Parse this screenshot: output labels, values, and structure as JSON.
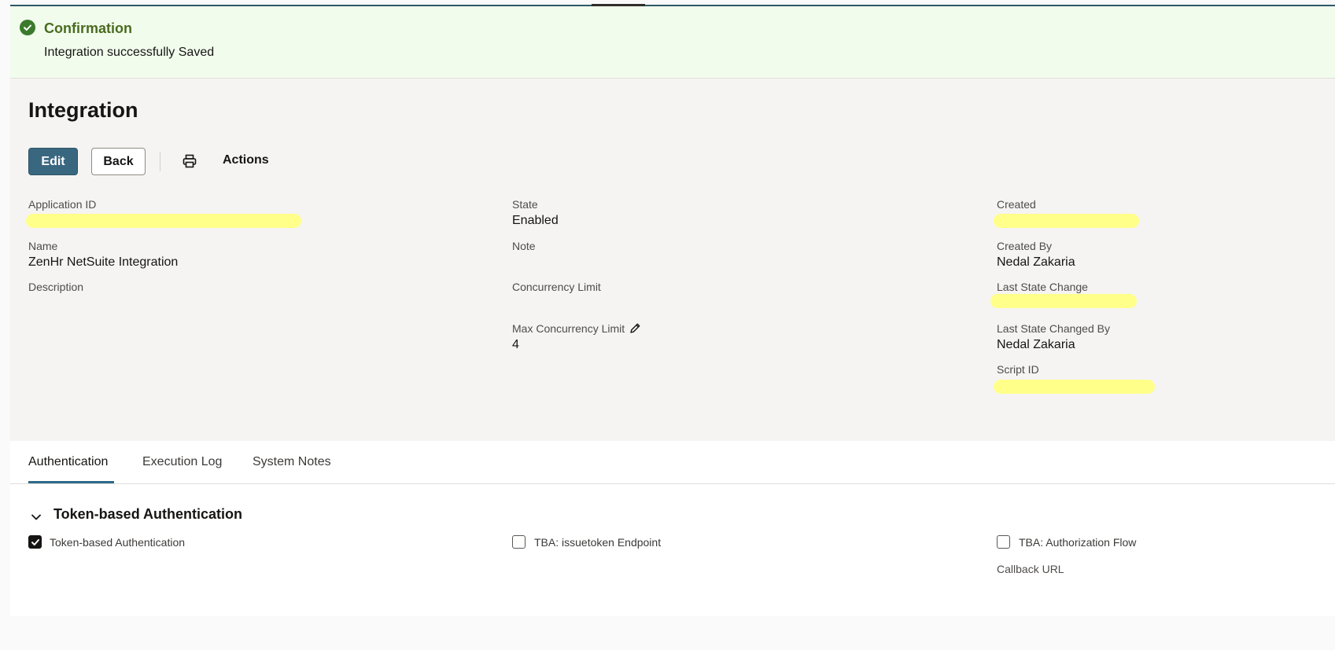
{
  "confirmation": {
    "title": "Confirmation",
    "message": "Integration successfully Saved",
    "icon": "check-circle-icon",
    "color": "#3b7a2c"
  },
  "header": {
    "title": "Integration",
    "edit_label": "Edit",
    "back_label": "Back",
    "print_icon": "print-icon",
    "actions_label": "Actions"
  },
  "fields": {
    "application_id": {
      "label": "Application ID"
    },
    "name": {
      "label": "Name",
      "value": "ZenHr NetSuite Integration"
    },
    "description": {
      "label": "Description"
    },
    "state": {
      "label": "State",
      "value": "Enabled"
    },
    "note": {
      "label": "Note"
    },
    "concurrency_limit": {
      "label": "Concurrency Limit"
    },
    "max_concurrency_limit": {
      "label": "Max Concurrency Limit",
      "value": "4"
    },
    "created": {
      "label": "Created"
    },
    "created_by": {
      "label": "Created By",
      "value": "Nedal Zakaria"
    },
    "last_state_change": {
      "label": "Last State Change"
    },
    "last_state_changed_by": {
      "label": "Last State Changed By",
      "value": "Nedal Zakaria"
    },
    "script_id": {
      "label": "Script ID"
    }
  },
  "tabs": [
    {
      "label": "Authentication",
      "active": true
    },
    {
      "label": "Execution Log",
      "active": false
    },
    {
      "label": "System Notes",
      "active": false
    }
  ],
  "auth_section": {
    "title": "Token-based Authentication",
    "checkboxes": [
      {
        "label": "Token-based Authentication",
        "checked": true
      },
      {
        "label": "TBA: issuetoken Endpoint",
        "checked": false
      },
      {
        "label": "TBA: Authorization Flow",
        "checked": false
      }
    ],
    "callback_label": "Callback URL"
  },
  "colors": {
    "accent": "#3a6780",
    "redaction": "#ffff8a",
    "tab_underline": "#2f6a8a"
  }
}
